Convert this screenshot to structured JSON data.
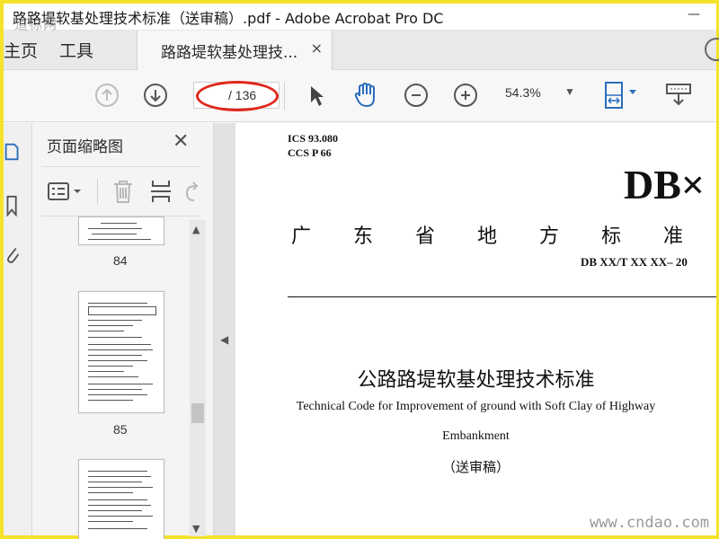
{
  "window": {
    "title": "路路堤软基处理技术标准（送审稿）.pdf - Adobe Acrobat Pro DC",
    "minimize": "—",
    "watermark_top": "道标网"
  },
  "tabs": {
    "home": "主页",
    "tools": "工具",
    "document": "路路堤软基处理技...",
    "close": "×"
  },
  "toolbar": {
    "page_current": "",
    "page_total": "/ 136",
    "zoom": "54.3%",
    "zoom_caret": "▼"
  },
  "thumbnails": {
    "heading": "页面缩略图",
    "close": "✕",
    "pages": [
      {
        "label": "84"
      },
      {
        "label": "85"
      }
    ]
  },
  "document": {
    "ics": "ICS   93.080",
    "ccs": "CCS   P 66",
    "db_mark": "DB×",
    "province_chars": [
      "广",
      "东",
      "省",
      "地",
      "方",
      "标",
      "准"
    ],
    "number": "DB XX/T    XX XX– 20",
    "title_cn": "公路路堤软基处理技术标准",
    "title_en_1": "Technical Code for Improvement of ground with Soft Clay of Highway",
    "title_en_2": "Embankment",
    "status": "（送审稿）"
  },
  "watermark_bottom": "www.cndao.com",
  "colors": {
    "frame": "#f5e22a",
    "annotation": "#e0271c",
    "hand_tool": "#2a6ebb",
    "fit_icon": "#2a6ebb"
  }
}
